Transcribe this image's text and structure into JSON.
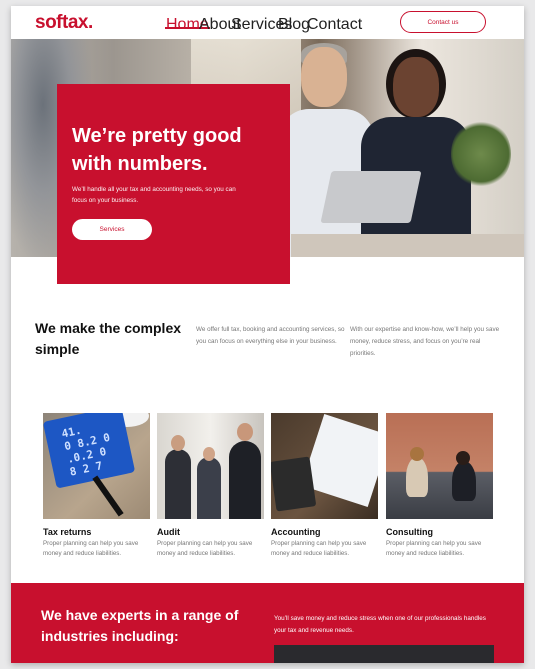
{
  "brand": {
    "logo": "softax.",
    "accent": "#c8102e"
  },
  "nav": {
    "items": [
      {
        "label": "Home",
        "active": true
      },
      {
        "label": "About"
      },
      {
        "label": "Services",
        "dropdown": true
      },
      {
        "label": "Blog"
      },
      {
        "label": "Contact"
      }
    ],
    "contact_button": "Contact us"
  },
  "hero": {
    "title": "We’re pretty good with numbers.",
    "subtitle": "We’ll handle all your tax and accounting needs, so you can focus on your business.",
    "button": "Services"
  },
  "intro": {
    "title": "We make the complex simple",
    "col1": "We offer full tax, booking and accounting services, so you can focus on everything else in your business.",
    "col2": "With our expertise and know-how, we’ll help you save money, reduce stress, and focus on you’re real priorities."
  },
  "services": [
    {
      "title": "Tax returns",
      "desc": "Proper planning can help you save money and reduce liabilities."
    },
    {
      "title": "Audit",
      "desc": "Proper planning can help you save money and reduce liabilities."
    },
    {
      "title": "Accounting",
      "desc": "Proper planning can help you save money and reduce liabilities."
    },
    {
      "title": "Consulting",
      "desc": "Proper planning can help you save money and reduce liabilities."
    }
  ],
  "experts": {
    "title": "We have experts in a range of industries including:",
    "text": "You’ll save money and reduce stress when one of our professionals handles your tax and revenue needs."
  }
}
